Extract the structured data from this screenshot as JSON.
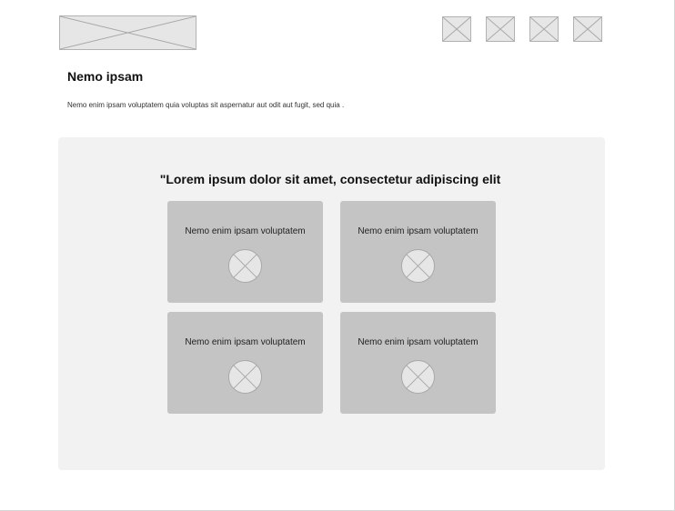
{
  "header": {
    "logo_icon": "image-placeholder-icon",
    "nav_icons": [
      "image-placeholder-icon",
      "image-placeholder-icon",
      "image-placeholder-icon",
      "image-placeholder-icon"
    ]
  },
  "intro": {
    "title": "Nemo  ipsam",
    "description": "Nemo enim ipsam voluptatem quia voluptas sit aspernatur aut odit aut fugit, sed quia ."
  },
  "feature": {
    "heading": "\"Lorem ipsum dolor sit amet, consectetur adipiscing elit",
    "cards": [
      {
        "label": "Nemo enim ipsam voluptatem",
        "icon": "image-placeholder-icon"
      },
      {
        "label": "Nemo enim ipsam voluptatem",
        "icon": "image-placeholder-icon"
      },
      {
        "label": "Nemo enim ipsam voluptatem",
        "icon": "image-placeholder-icon"
      },
      {
        "label": "Nemo enim ipsam voluptatem",
        "icon": "image-placeholder-icon"
      }
    ]
  },
  "colors": {
    "section_background": "#f2f2f2",
    "card_background": "#c4c4c4",
    "placeholder_fill": "#e6e6e6",
    "placeholder_stroke": "#b2b2b2"
  }
}
